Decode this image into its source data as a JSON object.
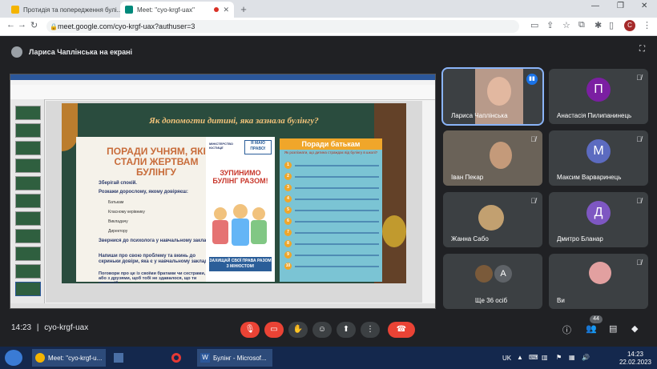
{
  "browser": {
    "tabs": [
      {
        "title": "Протидія та попередження булі...",
        "active": false
      },
      {
        "title": "Meet: \"cyo-krgf-uax\"",
        "active": true
      }
    ],
    "new_tab_label": "+",
    "url": "meet.google.com/cyo-krgf-uax?authuser=3",
    "profile_initial": "С"
  },
  "meet": {
    "presenter_banner": "Лариса Чаплінська на екрані",
    "meeting_code": "cyo-krgf-uax",
    "time": "14:23",
    "people_badge": "44",
    "colors": {
      "end_call": "#ea4335",
      "muted": "#ea4335",
      "accent": "#8ab4f8"
    }
  },
  "slide": {
    "title": "Як допомогти дитині, яка зазнала булінгу?",
    "left_heading": "ПОРАДИ УЧНЯМ, ЯКІ СТАЛИ ЖЕРТВАМ БУЛІНГУ",
    "ministry_label": "МІНІСТЕРСТВО ЮСТИЦІЇ",
    "logo_label": "Я МАЮ ПРАВО!",
    "tips": [
      "Зберігай спокій.",
      "Розкажи дорослому, якому довіряєш:",
      "Батькам",
      "Класному керівнику",
      "Викладачу",
      "Директору",
      "Звернися до психолога у навчальному закладі",
      "Напиши про свою проблему та вкинь до скриньки довіри, яка є у навчальному закладі",
      "Поговори про це із своїми братами чи сестрами, або з друзями, щоб тобі не здавалося, що ти самотній."
    ],
    "stop_text": "ЗУПИНИМО БУЛІНГ РАЗОМ!",
    "protect_text": "ЗАХИЩАЙ СВОЇ ПРАВА РАЗОМ З МІНЮСТОМ!",
    "parents_title": "Поради батькам",
    "parents_subtitle": "Як розпізнати, що дитина страждає від булінгу в школі?",
    "parents_numbers": [
      "1",
      "2",
      "3",
      "4",
      "5",
      "6",
      "7",
      "8",
      "9",
      "10"
    ]
  },
  "participants": [
    {
      "name": "Лариса Чаплінська",
      "video": true,
      "speaking": true
    },
    {
      "name": "Анастасія Пилипанинець",
      "initial": "П",
      "color": "#7b1fa2"
    },
    {
      "name": "Іван Пекар",
      "video": true
    },
    {
      "name": "Максим Варваринець",
      "initial": "М",
      "color": "#5c6bc0"
    },
    {
      "name": "Жанна Сабо",
      "video": true
    },
    {
      "name": "Дмитро Бланар",
      "initial": "Д",
      "color": "#7e57c2"
    },
    {
      "name": "Ще 36 осіб",
      "initial": "А",
      "color": "#5f6368"
    },
    {
      "name": "Ви",
      "video": true
    }
  ],
  "taskbar": {
    "start_icon": "windows-logo",
    "items": [
      {
        "label": "Meet: \"cyo-krgf-u...",
        "icon": "chrome-icon"
      },
      {
        "label": "",
        "icon": "save-icon"
      },
      {
        "label": "",
        "icon": "opera-icon"
      },
      {
        "label": "Булінг - Microsof...",
        "icon": "word-icon"
      }
    ],
    "language": "UK",
    "clock_time": "14:23",
    "clock_date": "22.02.2023"
  }
}
